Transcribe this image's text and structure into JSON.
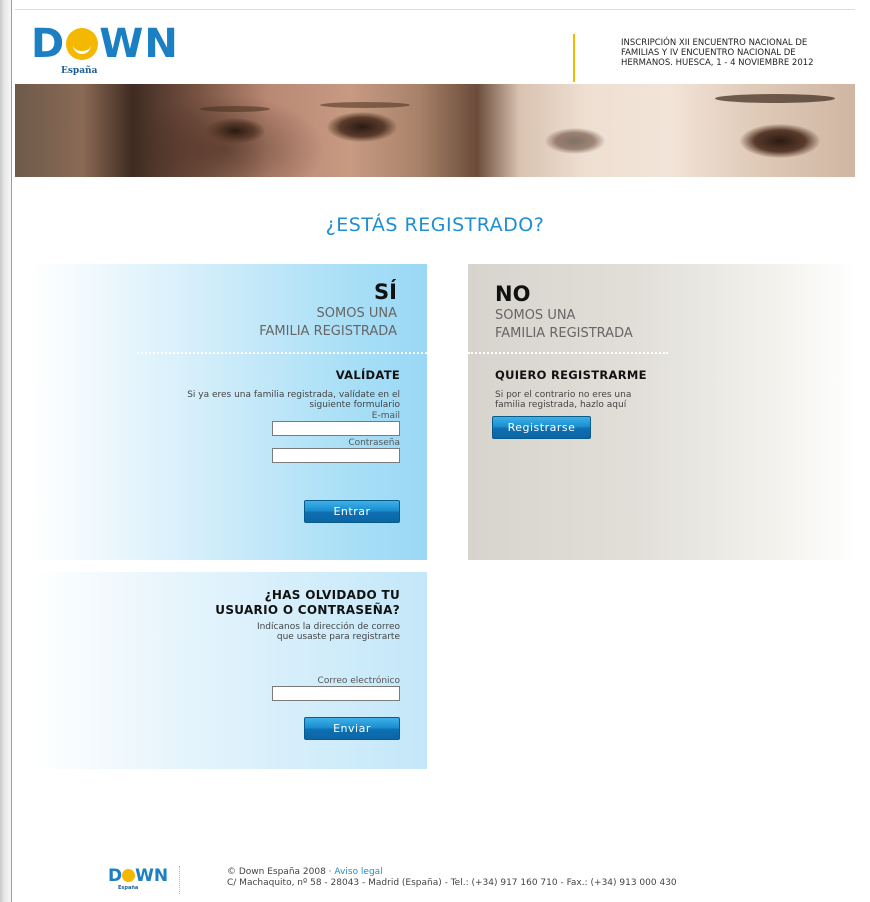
{
  "header": {
    "logo_text": "DOWN",
    "logo_sub": "España",
    "event_text": "INSCRIPCIÓN XII ENCUENTRO NACIONAL DE FAMILIAS Y IV ENCUENTRO NACIONAL DE HERMANOS. HUESCA, 1 - 4 NOVIEMBRE 2012",
    "accent_color": "#f5b800",
    "brand_color": "#1b7fc4"
  },
  "main": {
    "question": "¿ESTÁS REGISTRADO?"
  },
  "panel_si": {
    "title": "SÍ",
    "subtitle_line1": "SOMOS UNA",
    "subtitle_line2": "FAMILIA REGISTRADA",
    "section_title": "VALÍDATE",
    "description": "Si ya eres una familia registrada, valídate en el siguiente formulario",
    "email_label": "E-mail",
    "email_value": "",
    "password_label": "Contraseña",
    "password_value": "",
    "submit_label": "Entrar"
  },
  "panel_no": {
    "title": "NO",
    "subtitle_line1": "SOMOS UNA",
    "subtitle_line2": "FAMILIA REGISTRADA",
    "section_title": "QUIERO REGISTRARME",
    "description": "Si por el contrario no eres una familia registrada, hazlo aquí",
    "register_label": "Registrarse"
  },
  "panel_forgot": {
    "title_line1": "¿HAS OLVIDADO TU",
    "title_line2": "USUARIO O CONTRASEÑA?",
    "description": "Indícanos la dirección de correo que usaste para registrarte",
    "email_label": "Correo electrónico",
    "email_value": "",
    "submit_label": "Enviar"
  },
  "footer": {
    "logo_text": "DOWN",
    "copyright": "© Down España 2008 ·",
    "legal_link": "Aviso legal",
    "address": "C/ Machaquito, nº 58 - 28043 - Madrid (España) - Tel.: (+34) 917 160 710 - Fax.: (+34) 913 000 430"
  }
}
